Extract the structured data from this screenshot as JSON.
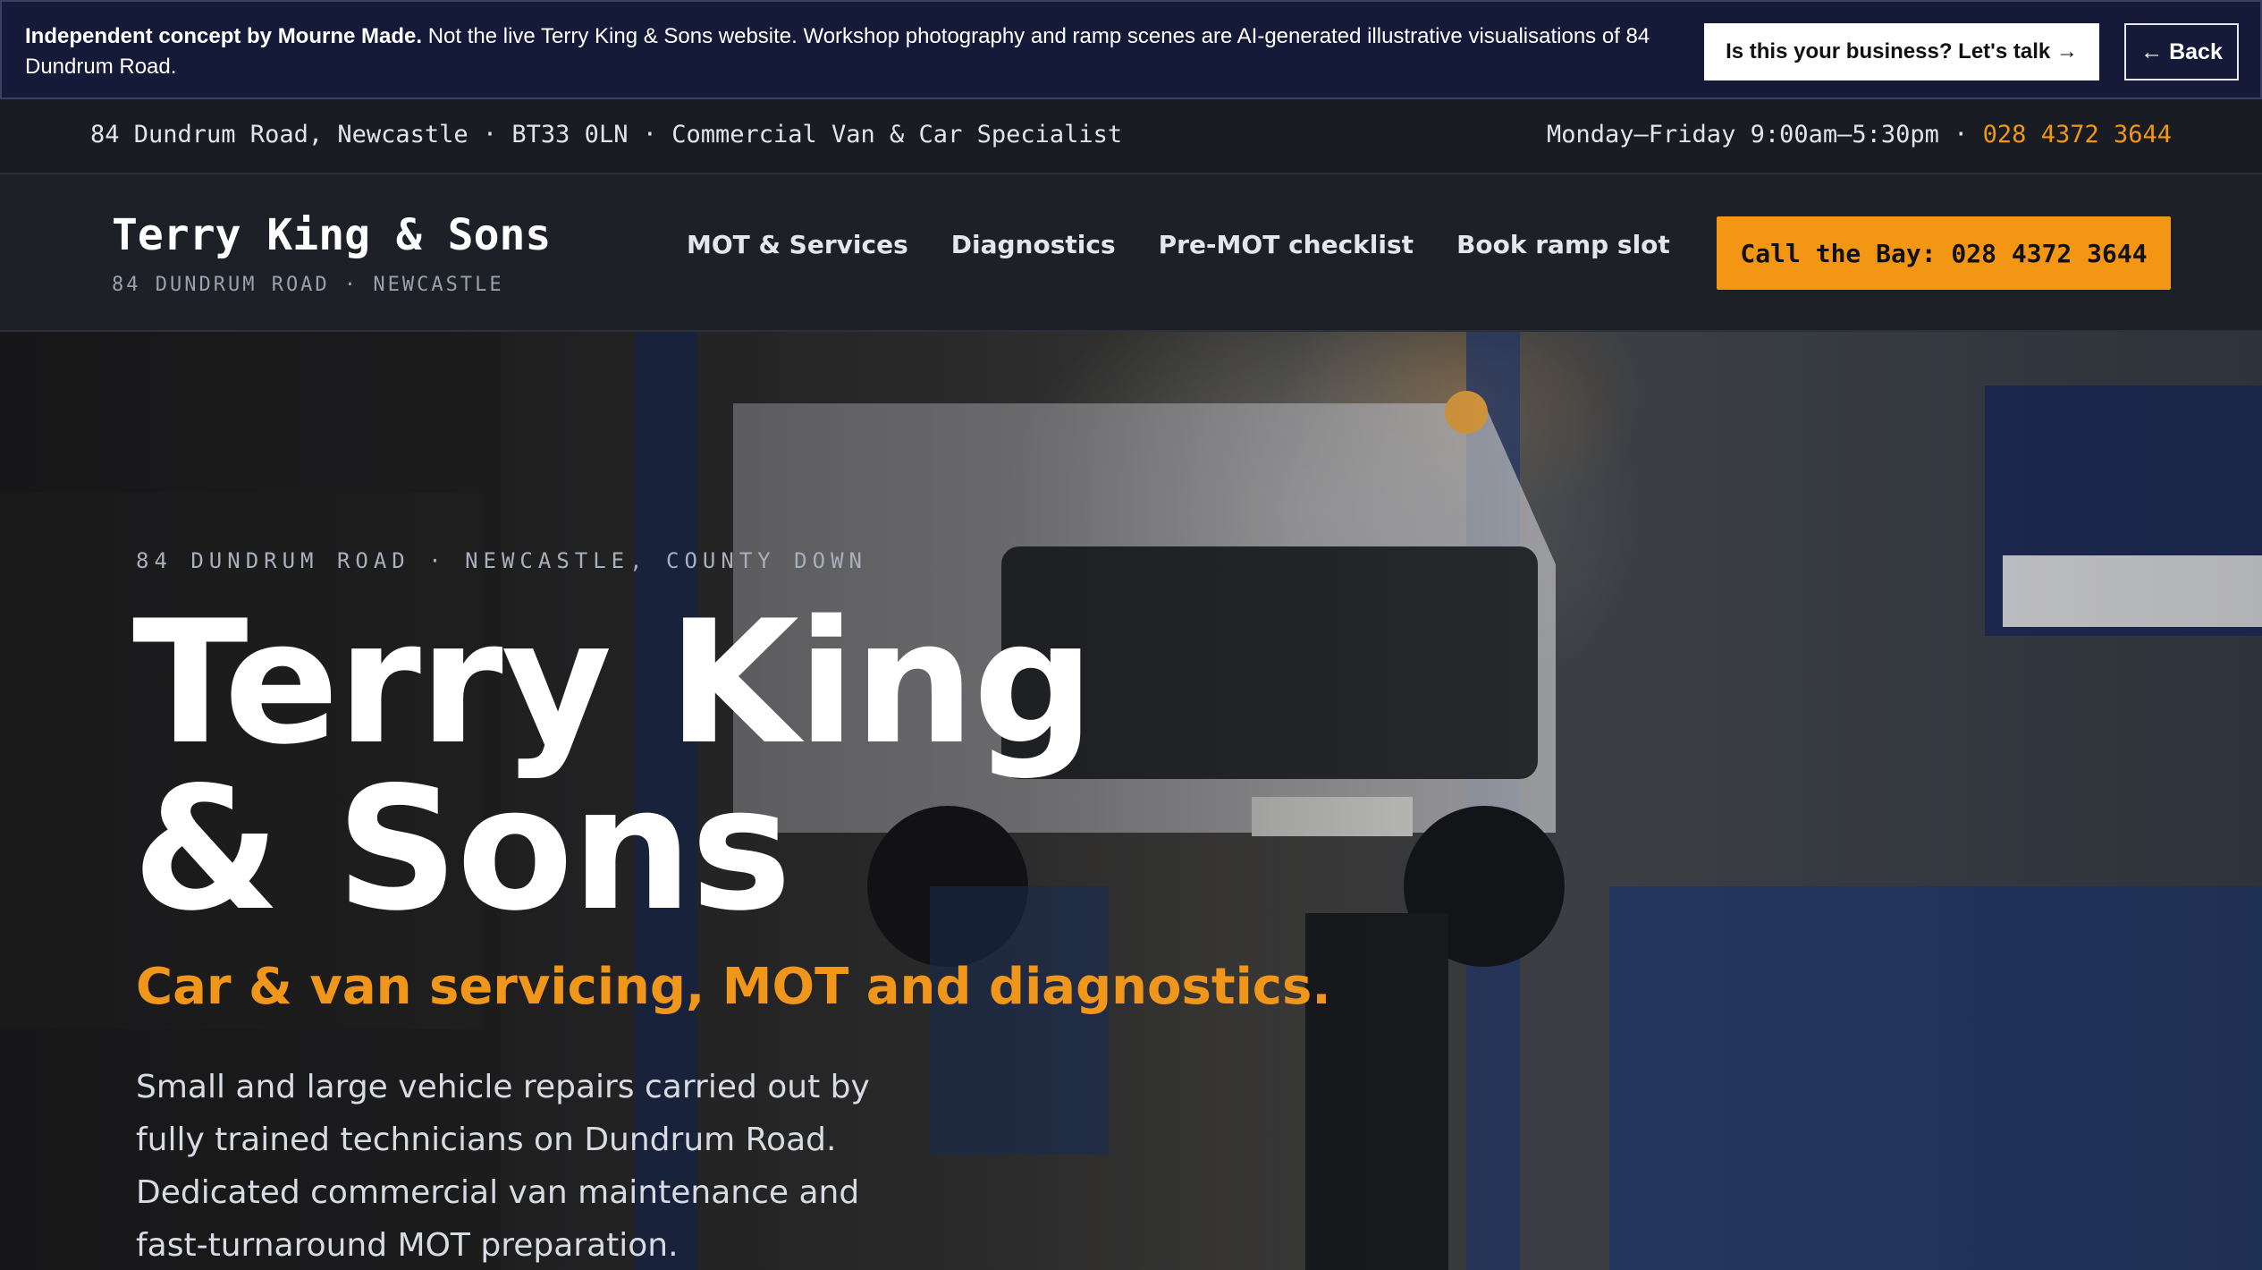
{
  "notice": {
    "bold": "Independent concept by Mourne Made.",
    "text": " Not the live Terry King & Sons website. Workshop photography and ramp scenes are AI-generated illustrative visualisations of 84 Dundrum Road.",
    "cta_label": "Is this your business? Let's talk →",
    "back_label": "← Back"
  },
  "infobar": {
    "address": "84 Dundrum Road, Newcastle · BT33 0LN · Commercial Van & Car Specialist",
    "hours": "Monday–Friday 9:00am–5:30pm · ",
    "phone": "028 4372 3644"
  },
  "header": {
    "brand_title": "Terry King & Sons",
    "brand_subtitle": "84 DUNDRUM ROAD · NEWCASTLE",
    "nav": [
      {
        "label": "MOT & Services"
      },
      {
        "label": "Diagnostics"
      },
      {
        "label": "Pre-MOT checklist"
      },
      {
        "label": "Book ramp slot"
      }
    ],
    "call_label": "Call the Bay: 028 4372 3644"
  },
  "hero": {
    "eyebrow": "84 DUNDRUM ROAD · NEWCASTLE, COUNTY DOWN",
    "title_line1": "Terry King",
    "title_line2": "& Sons",
    "tagline": "Car & van servicing, MOT and diagnostics.",
    "description": "Small and large vehicle repairs carried out by fully trained technicians on Dundrum Road. Dedicated commercial van maintenance and fast-turnaround MOT preparation."
  },
  "colors": {
    "accent": "#f29614",
    "notice_bg": "#141a38",
    "header_bg": "#1d2027"
  }
}
